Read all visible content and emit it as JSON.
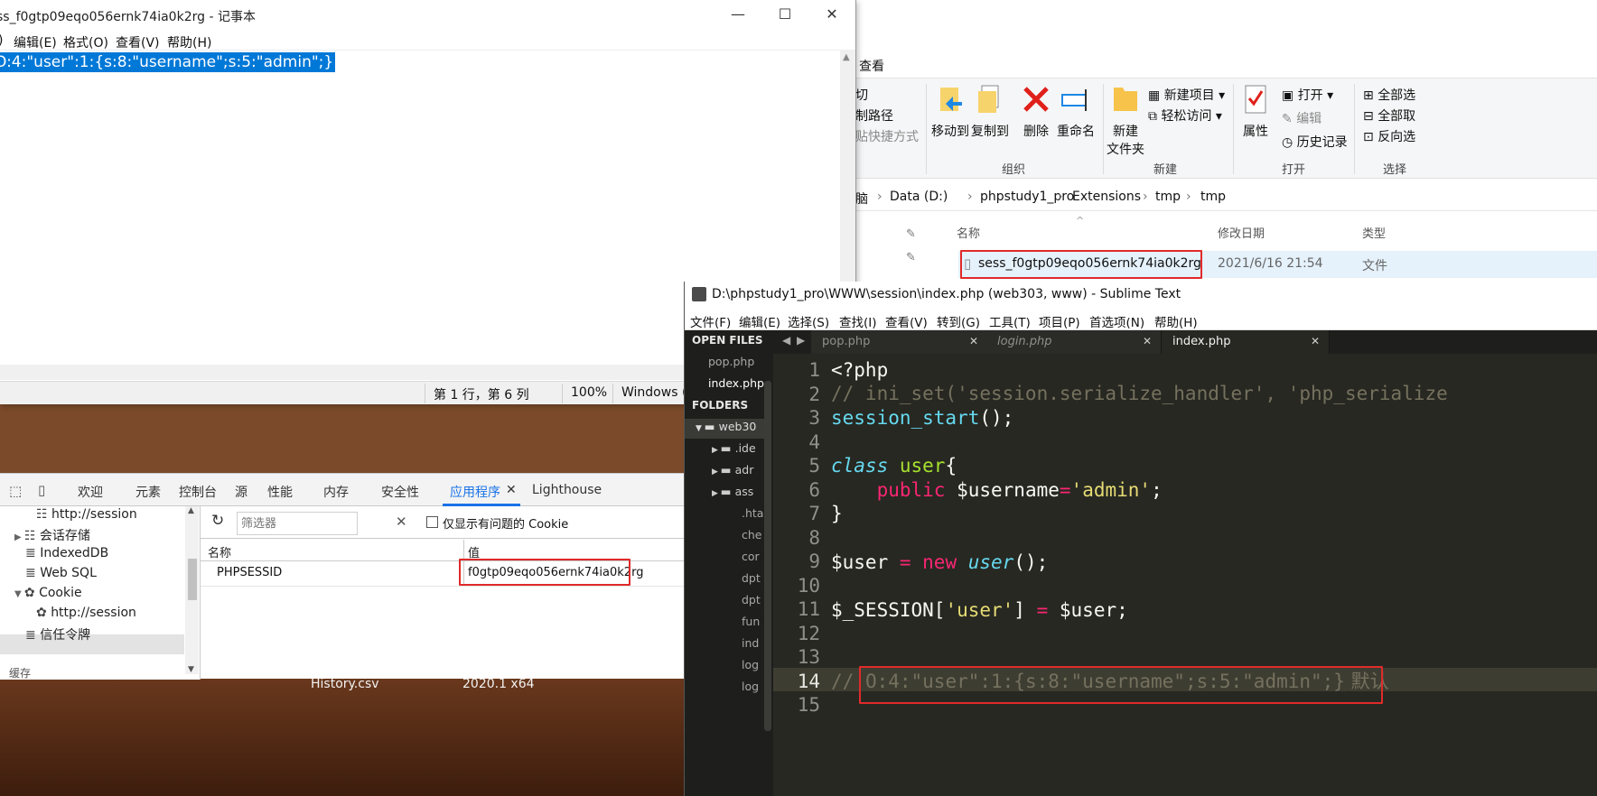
{
  "desktop": {
    "items": [
      "History.csv",
      "2020.1 x64"
    ]
  },
  "explorer": {
    "tab_view": "查看",
    "clipboard": {
      "cut": "切",
      "copy_path": "制路径",
      "paste_shortcut": "贴快捷方式"
    },
    "organize": {
      "move_to": "移动到",
      "copy_to": "复制到",
      "delete": "删除",
      "rename": "重命名",
      "label": "组织"
    },
    "new": {
      "new_folder_1": "新建",
      "new_folder_2": "文件夹",
      "new_item": "新建项目",
      "easy_access": "轻松访问",
      "label": "新建"
    },
    "open": {
      "properties": "属性",
      "open": "打开",
      "edit": "编辑",
      "history": "历史记录",
      "label": "打开"
    },
    "select": {
      "select_all": "全部选",
      "select_none": "全部取",
      "invert": "反向选",
      "label": "选择"
    },
    "breadcrumb": [
      "脑",
      "Data (D:)",
      "phpstudy1_pro",
      "Extensions",
      "tmp",
      "tmp"
    ],
    "columns": {
      "name": "名称",
      "modified": "修改日期",
      "type": "类型"
    },
    "file": {
      "name": "sess_f0gtp09eqo056ernk74ia0k2rg",
      "modified": "2021/6/16 21:54",
      "type": "文件"
    }
  },
  "notepad": {
    "title": "ss_f0gtp09eqo056ernk74ia0k2rg - 记事本",
    "menu": [
      ")",
      "编辑(E)",
      "格式(O)",
      "查看(V)",
      "帮助(H)"
    ],
    "content": "O:4:\"user\":1:{s:8:\"username\";s:5:\"admin\";}",
    "status": {
      "position": "第 1 行，第 6 列",
      "zoom": "100%",
      "encoding": "Windows ("
    }
  },
  "devtools": {
    "tabs": [
      "欢迎",
      "元素",
      "控制台",
      "源",
      "性能",
      "内存",
      "安全性",
      "应用程序",
      "Lighthouse"
    ],
    "active_tab": "应用程序",
    "sidebar": [
      {
        "label": "http://session"
      },
      {
        "label": "会话存储"
      },
      {
        "label": "IndexedDB"
      },
      {
        "label": "Web SQL"
      },
      {
        "label": "Cookie"
      },
      {
        "label": "http://session"
      },
      {
        "label": "信任令牌"
      },
      {
        "label": "缓存"
      }
    ],
    "filter_placeholder": "筛选器",
    "only_issues_label": "仅显示有问题的 Cookie",
    "table": {
      "col_name": "名称",
      "col_value": "值",
      "rows": [
        {
          "name": "PHPSESSID",
          "value": "f0gtp09eqo056ernk74ia0k2rg"
        }
      ]
    }
  },
  "sublime": {
    "title": "D:\\phpstudy1_pro\\WWW\\session\\index.php (web303, www) - Sublime Text",
    "menu": [
      "文件(F)",
      "编辑(E)",
      "选择(S)",
      "查找(I)",
      "查看(V)",
      "转到(G)",
      "工具(T)",
      "项目(P)",
      "首选项(N)",
      "帮助(H)"
    ],
    "sidebar": {
      "open_files_label": "OPEN FILES",
      "open_files": [
        "pop.php",
        "index.php"
      ],
      "folders_label": "FOLDERS",
      "folders": [
        "web30",
        ".ide",
        "adr",
        "ass"
      ],
      "files": [
        ".hta",
        "che",
        "cor",
        "dpt",
        "dpt",
        "fun",
        "ind",
        "log",
        "log"
      ]
    },
    "tabs": [
      "pop.php",
      "login.php",
      "index.php"
    ],
    "line_numbers": [
      "1",
      "2",
      "3",
      "4",
      "5",
      "6",
      "7",
      "8",
      "9",
      "10",
      "11",
      "12",
      "13",
      "14",
      "15"
    ],
    "code": {
      "l1": "<?php",
      "l2": "// ini_set('session.serialize_handler', 'php_serialize",
      "l3_fn": "session_start",
      "l3_rest": "();",
      "l5_kw": "class",
      "l5_name": "user",
      "l5_rest": "{",
      "l6_kw": "public",
      "l6_var": "$username",
      "l6_eq": "=",
      "l6_str": "'admin'",
      "l6_end": ";",
      "l7": "}",
      "l9_var": "$user",
      "l9_eq": " = ",
      "l9_new": "new",
      "l9_cls": "user",
      "l9_end": "();",
      "l11_a": "$_SESSION[",
      "l11_str": "'user'",
      "l11_b": "] ",
      "l11_eq": "=",
      "l11_c": " $user;",
      "l14_a": "// ",
      "l14_b": "O:4:\"user\":1:{s:8:\"username\";s:5:\"admin\";}",
      "l14_c": " 默认"
    }
  }
}
